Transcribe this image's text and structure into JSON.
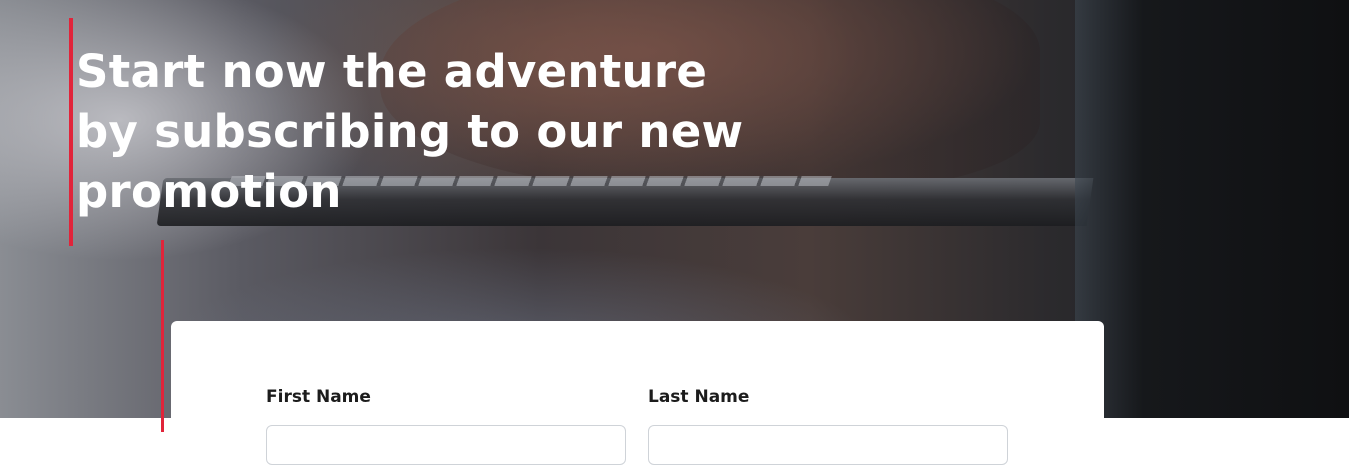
{
  "hero": {
    "title": "Start now the adventure by subscribing to our new promotion"
  },
  "form": {
    "first_name_label": "First Name",
    "last_name_label": "Last Name",
    "first_name_value": "",
    "last_name_value": ""
  },
  "colors": {
    "accent": "#e1243a",
    "card": "#ffffff",
    "title_text": "#ffffff"
  }
}
